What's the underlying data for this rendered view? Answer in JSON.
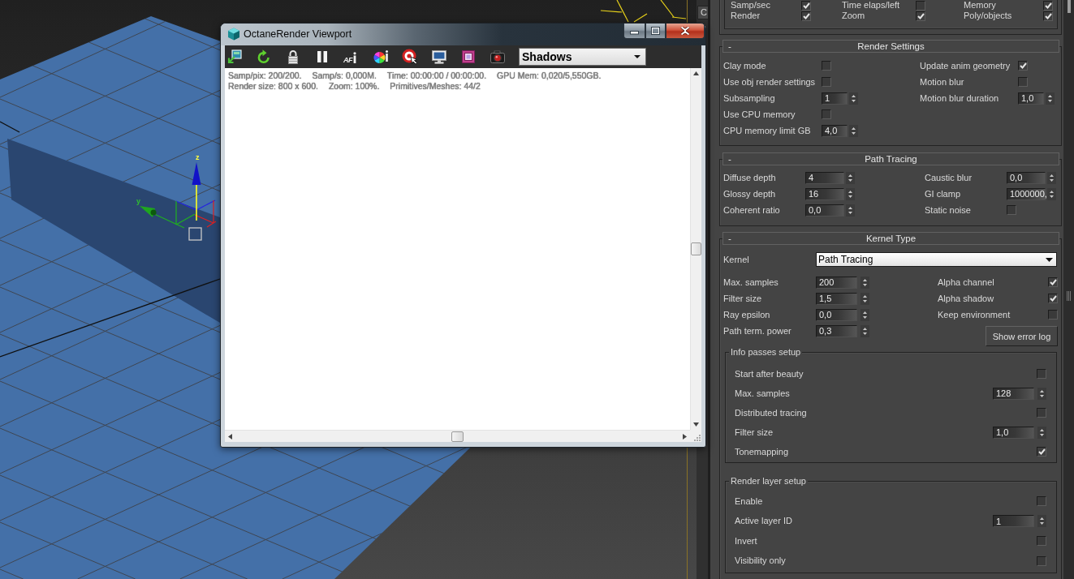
{
  "scene": {
    "gizmo_labels": [
      "z",
      "y"
    ]
  },
  "side_strip": {
    "button_label": "C"
  },
  "octane_window": {
    "title": "OctaneRender Viewport",
    "toolbar": {
      "button_text": "AF",
      "pass_dropdown": "Shadows"
    },
    "info_lines": [
      [
        "Samp/pix: 200/200.",
        "Samp/s: 0,000M.",
        "Time: 00:00:00 / 00:00:00.",
        "GPU Mem: 0,020/5,550GB."
      ],
      [
        "Render size: 800 x 600.",
        "Zoom: 100%.",
        "Primitives/Meshes: 44/2"
      ]
    ]
  },
  "command_panel": {
    "rollouts": [
      {
        "columns": [
          [
            {
              "kind": "checkbox",
              "label": "Samp/sec",
              "checked": true
            },
            {
              "kind": "checkbox",
              "label": "Render",
              "checked": true
            }
          ],
          [
            {
              "kind": "checkbox",
              "label": "Time elaps/left",
              "checked": false
            },
            {
              "kind": "checkbox",
              "label": "Zoom",
              "checked": true
            }
          ],
          [
            {
              "kind": "checkbox",
              "label": "Memory",
              "checked": true
            },
            {
              "kind": "checkbox",
              "label": "Poly/objects",
              "checked": true
            }
          ]
        ]
      },
      {
        "title": "Render Settings",
        "toggle": "-",
        "columns": [
          [
            {
              "kind": "checkbox",
              "label": "Clay mode",
              "checked": false
            },
            {
              "kind": "checkbox",
              "label": "Use obj render settings",
              "checked": false
            },
            {
              "kind": "spinner",
              "label": "Subsampling",
              "value": "1"
            },
            {
              "kind": "checkbox",
              "label": "Use CPU memory",
              "checked": false
            },
            {
              "kind": "spinner",
              "label": "CPU memory limit GB",
              "value": "4,0"
            }
          ],
          [
            {
              "kind": "checkbox",
              "label": "Update anim geometry",
              "checked": true
            },
            {
              "kind": "checkbox",
              "label": "Motion blur",
              "checked": false
            },
            {
              "kind": "spinner",
              "label": "Motion blur duration",
              "value": "1,0"
            }
          ]
        ]
      },
      {
        "title": "Path Tracing",
        "toggle": "-",
        "columns": [
          [
            {
              "kind": "spinner",
              "label": "Diffuse depth",
              "value": "4"
            },
            {
              "kind": "spinner",
              "label": "Glossy depth",
              "value": "16"
            },
            {
              "kind": "spinner",
              "label": "Coherent ratio",
              "value": "0,0"
            }
          ],
          [
            {
              "kind": "spinner",
              "label": "Caustic blur",
              "value": "0,0"
            },
            {
              "kind": "spinner",
              "label": "GI clamp",
              "value": "1000000,"
            },
            {
              "kind": "checkbox",
              "label": "Static noise",
              "checked": false
            }
          ]
        ]
      },
      {
        "title": "Kernel Type",
        "toggle": "-",
        "fields": [
          {
            "kind": "dropdown",
            "label": "Kernel",
            "value": "Path Tracing"
          }
        ],
        "columns": [
          [
            {
              "kind": "spinner",
              "label": "Max. samples",
              "value": "200"
            },
            {
              "kind": "spinner",
              "label": "Filter size",
              "value": "1,5"
            },
            {
              "kind": "spinner",
              "label": "Ray epsilon",
              "value": "0,0"
            },
            {
              "kind": "spinner",
              "label": "Path term. power",
              "value": "0,3"
            }
          ],
          [
            {
              "kind": "checkbox",
              "label": "Alpha channel",
              "checked": true
            },
            {
              "kind": "checkbox",
              "label": "Alpha shadow",
              "checked": true
            },
            {
              "kind": "checkbox",
              "label": "Keep environment",
              "checked": false
            },
            {
              "kind": "button",
              "label": "Show error log"
            }
          ]
        ],
        "groups": [
          {
            "title": "Info passes setup",
            "fields": [
              {
                "kind": "checkbox",
                "label": "Start after beauty",
                "checked": false
              },
              {
                "kind": "spinner",
                "label": "Max. samples",
                "value": "128"
              },
              {
                "kind": "checkbox",
                "label": "Distributed tracing",
                "checked": false
              },
              {
                "kind": "spinner",
                "label": "Filter size",
                "value": "1,0"
              },
              {
                "kind": "checkbox",
                "label": "Tonemapping",
                "checked": true
              }
            ]
          },
          {
            "title": "Render layer setup",
            "fields": [
              {
                "kind": "checkbox",
                "label": "Enable",
                "checked": false
              },
              {
                "kind": "spinner",
                "label": "Active layer ID",
                "value": "1"
              },
              {
                "kind": "checkbox",
                "label": "Invert",
                "checked": false
              },
              {
                "kind": "checkbox",
                "label": "Visibility only",
                "checked": false
              }
            ]
          }
        ]
      }
    ]
  }
}
